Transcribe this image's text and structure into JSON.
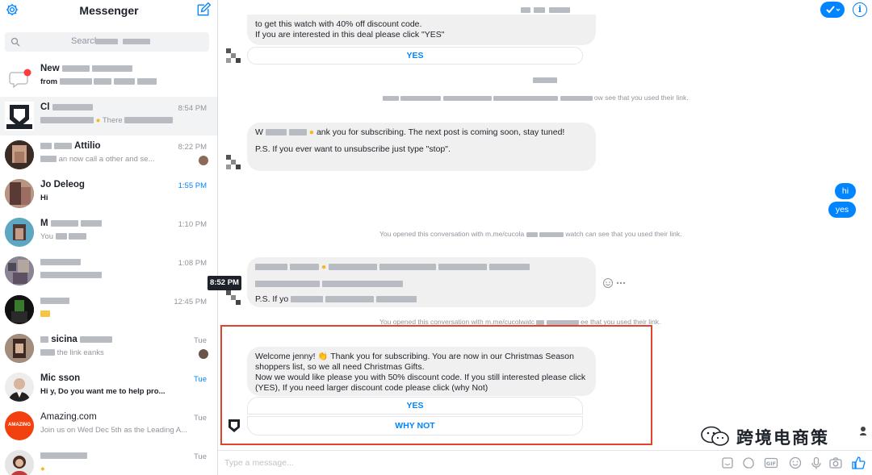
{
  "sidebar": {
    "title": "Messenger",
    "search_placeholder": "Search",
    "conversations": [
      {
        "name": "New",
        "preview": "from",
        "time": "",
        "icon": "message-request-icon"
      },
      {
        "name": "Cl",
        "preview": "There",
        "time": "8:54 PM"
      },
      {
        "name": "Attilio",
        "preview": "an now call a other and se...",
        "time": "8:22 PM"
      },
      {
        "name": "Jo Deleog",
        "preview": "Hi",
        "time": "1:55 PM"
      },
      {
        "name": "M",
        "preview": "You",
        "time": "1:10 PM"
      },
      {
        "name": "",
        "preview": "",
        "time": "1:08 PM"
      },
      {
        "name": "",
        "preview": "",
        "time": "12:45 PM"
      },
      {
        "name": "sicina",
        "preview": "the link eanks",
        "time": "Tue"
      },
      {
        "name": "Mic sson",
        "preview": "Hi y, Do you want me to help pro...",
        "time": "Tue"
      },
      {
        "name": "Amazing.com",
        "preview": "Join us on Wed Dec 5th as the Leading A...",
        "time": "Tue",
        "avatar_text": "AMAZING"
      },
      {
        "name": "",
        "preview": "",
        "time": "Tue"
      }
    ]
  },
  "main": {
    "top_message_line1": "to get this watch with 40% off discount code.",
    "top_message_line2": "If you are interested in this deal please click \"YES\"",
    "top_yes": "YES",
    "note1": "ow see that you used their link.",
    "msg2_start": "W",
    "msg2_rest": "ank you for subscribing. The next post is coming soon, stay tuned!",
    "msg2_ps": "P.S. If you ever want to unsubscribe just type \"stop\".",
    "out1": "hi",
    "out2": "yes",
    "note2_pre": "You opened this conversation with m.me/cucola",
    "note2_post": "watch can see that you used their link.",
    "time_tip": "8:52 PM",
    "msg3_ps": "P.S. If yo",
    "note3": "You opened this conversation with m.me/cucolwatc",
    "note3_post": "ee that you used their link.",
    "welcome_text": "Welcome jenny! 👏 Thank you for subscribing.  You are now in our Christmas Season shoppers list, so we all need Christmas Gifts.\nNow we would like please you with 50% discount code. If you still interested please click (YES), If you need larger discount code please click (why Not)",
    "btn_yes": "YES",
    "btn_why_not": "WHY NOT",
    "composer_placeholder": "Type a message...",
    "watermark_text": "跨境电商策"
  }
}
